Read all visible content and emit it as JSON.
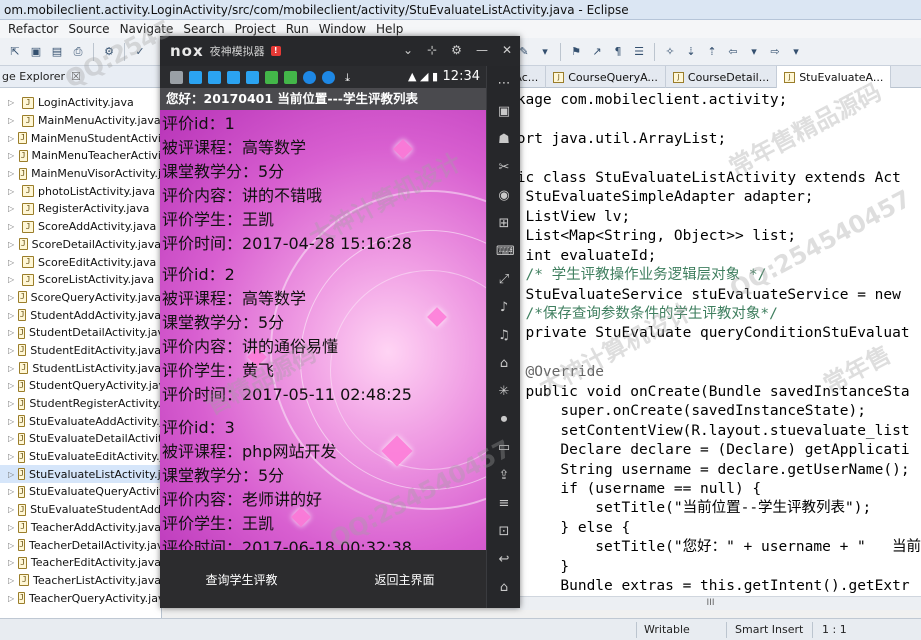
{
  "window": {
    "title": "om.mobileclient.activity.LoginActivity/src/com/mobileclient/activity/StuEvaluateListActivity.java - Eclipse"
  },
  "menu": [
    "Refactor",
    "Source",
    "Navigate",
    "Search",
    "Project",
    "Run",
    "Window",
    "Help"
  ],
  "package_explorer": {
    "title": "ge Explorer",
    "close": "☒",
    "items": [
      "LoginActivity.java",
      "MainMenuActivity.java",
      "MainMenuStudentActivi",
      "MainMenuTeacherActivi",
      "MainMenuVisorActivity.j",
      "photoListActivity.java",
      "RegisterActivity.java",
      "ScoreAddActivity.java",
      "ScoreDetailActivity.java",
      "ScoreEditActivity.java",
      "ScoreListActivity.java",
      "ScoreQueryActivity.java",
      "StudentAddActivity.java",
      "StudentDetailActivity.java",
      "StudentEditActivity.java",
      "StudentListActivity.java",
      "StudentQueryActivity.java",
      "StudentRegisterActivity.",
      "StuEvaluateAddActivity.j",
      "StuEvaluateDetailActivity",
      "StuEvaluateEditActivity.j",
      "StuEvaluateListActivity.jav",
      "StuEvaluateQueryActivit",
      "StuEvaluateStudentAdd",
      "TeacherAddActivity.java",
      "TeacherDetailActivity.java",
      "TeacherEditActivity.java",
      "TeacherListActivity.java",
      "TeacherQueryActivity.jav"
    ]
  },
  "editor": {
    "tabs": [
      "itAc...",
      "CourseQueryA...",
      "CourseDetail...",
      "StuEvaluateA..."
    ],
    "lines": [
      "ckage com.mobileclient.activity;",
      "",
      "port java.util.ArrayList;",
      "",
      "lic class StuEvaluateListActivity extends Act",
      "  StuEvaluateSimpleAdapter adapter;",
      "  ListView lv;",
      "  List<Map<String, Object>> list;",
      "  int evaluateId;",
      "  /* 学生评教操作业务逻辑层对象 */",
      "  StuEvaluateService stuEvaluateService = new",
      "  /*保存查询参数条件的学生评教对象*/",
      "  private StuEvaluate queryConditionStuEvaluat",
      "",
      "  @Override",
      "  public void onCreate(Bundle savedInstanceSta",
      "      super.onCreate(savedInstanceState);",
      "      setContentView(R.layout.stuevaluate_list",
      "      Declare declare = (Declare) getApplicati",
      "      String username = declare.getUserName();",
      "      if (username == null) {",
      "          setTitle(\"当前位置--学生评教列表\");",
      "      } else {",
      "          setTitle(\"您好：\" + username + \"   当前",
      "      }",
      "      Bundle extras = this.getIntent().getExtr"
    ],
    "hscroll": "III"
  },
  "status": {
    "writable": "Writable",
    "insert_mode": "Smart Insert",
    "position": "1 : 1"
  },
  "emulator": {
    "logo": "nox",
    "title": "夜神模拟器",
    "alert": "!",
    "clock": "12:34",
    "action_title": "您好：20170401   当前位置---学生评教列表",
    "records": [
      {
        "id": "评价id：1",
        "course": "被评课程：高等数学",
        "credit": "课堂教学分：5分",
        "content": "评价内容：讲的不错哦",
        "student": "评价学生：王凯",
        "time": "评价时间：2017-04-28 15:16:28"
      },
      {
        "id": "评价id：2",
        "course": "被评课程：高等数学",
        "credit": "课堂教学分：5分",
        "content": "评价内容：讲的通俗易懂",
        "student": "评价学生：黄飞",
        "time": "评价时间：2017-05-11 02:48:25"
      },
      {
        "id": "评价id：3",
        "course": "被评课程：php网站开发",
        "credit": "课堂教学分：5分",
        "content": "评价内容：老师讲的好",
        "student": "评价学生：王凯",
        "time": "评价时间：2017-06-18 00:32:38"
      }
    ],
    "buttons": {
      "query": "查询学生评教",
      "back": "返回主界面"
    }
  },
  "watermarks": [
    "QQ:2545",
    "大神计算机设计",
    "常年售精品源码",
    "QQ:254540457",
    "QQ:254540457",
    "售精品源码",
    "大神计算机设计",
    "常年售"
  ]
}
